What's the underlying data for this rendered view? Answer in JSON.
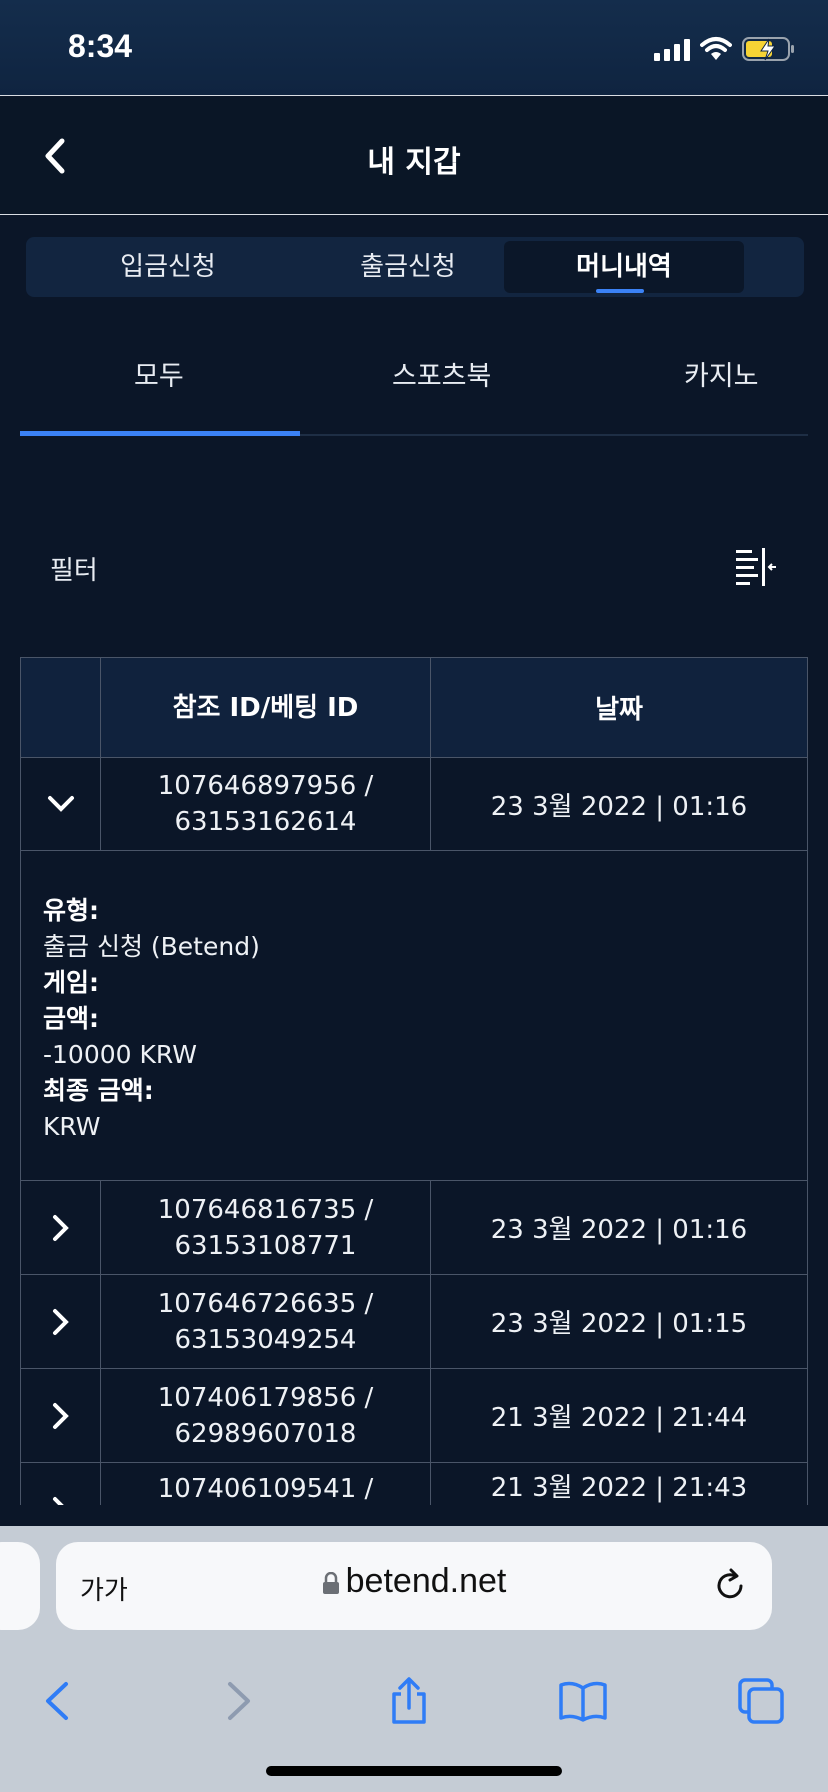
{
  "status": {
    "time": "8:34"
  },
  "header": {
    "title": "내 지갑"
  },
  "segments": [
    {
      "label": "입금신청"
    },
    {
      "label": "출금신청"
    },
    {
      "label": "머니내역"
    }
  ],
  "tabs": [
    {
      "label": "모두"
    },
    {
      "label": "스포츠북"
    },
    {
      "label": "카지노"
    }
  ],
  "filter": {
    "label": "필터"
  },
  "table": {
    "headers": {
      "id": "참조 ID/베팅 ID",
      "date": "날짜"
    },
    "rows": [
      {
        "id_line1": "107646897956 /",
        "id_line2": "63153162614",
        "date": "23 3월 2022 | 01:16",
        "expanded": true
      },
      {
        "id_line1": "107646816735 /",
        "id_line2": "63153108771",
        "date": "23 3월 2022 | 01:16"
      },
      {
        "id_line1": "107646726635 /",
        "id_line2": "63153049254",
        "date": "23 3월 2022 | 01:15"
      },
      {
        "id_line1": "107406179856 /",
        "id_line2": "62989607018",
        "date": "21 3월 2022 | 21:44"
      },
      {
        "id_line1": "107406109541 /",
        "id_line2": "",
        "date": "21 3월 2022 | 21:43"
      }
    ],
    "details": {
      "type_label": "유형:",
      "type_value": "출금 신청 (Betend)",
      "game_label": "게임:",
      "amount_label": "금액:",
      "amount_value": "-10000 KRW",
      "final_label": "최종 금액:",
      "final_value": "KRW"
    }
  },
  "browser": {
    "text_size": "가가",
    "url": "betend.net"
  }
}
